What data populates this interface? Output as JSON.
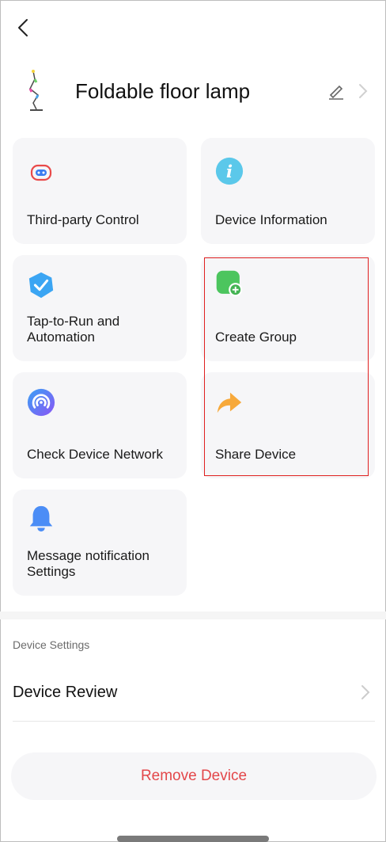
{
  "header": {
    "device_name": "Foldable floor lamp"
  },
  "cards": [
    {
      "label": "Third-party Control",
      "icon": "third-party-control-icon"
    },
    {
      "label": "Device Information",
      "icon": "info-icon"
    },
    {
      "label": "Tap-to-Run and Automation",
      "icon": "automation-check-icon"
    },
    {
      "label": "Create Group",
      "icon": "create-group-icon"
    },
    {
      "label": "Check Device Network",
      "icon": "network-icon"
    },
    {
      "label": "Share Device",
      "icon": "share-arrow-icon"
    },
    {
      "label": "Message notification Settings",
      "icon": "bell-icon"
    }
  ],
  "settings": {
    "section_title": "Device Settings",
    "review_label": "Device Review"
  },
  "remove_button": {
    "label": "Remove Device"
  },
  "colors": {
    "danger": "#e3474a",
    "info_blue": "#5bc8ea",
    "automation_blue": "#3ba5f3",
    "group_green": "#4cc55e",
    "network_purple": "#6c63f6",
    "share_orange": "#f7a93b",
    "bell_blue": "#4b8df6",
    "highlight_red": "#e02020"
  }
}
